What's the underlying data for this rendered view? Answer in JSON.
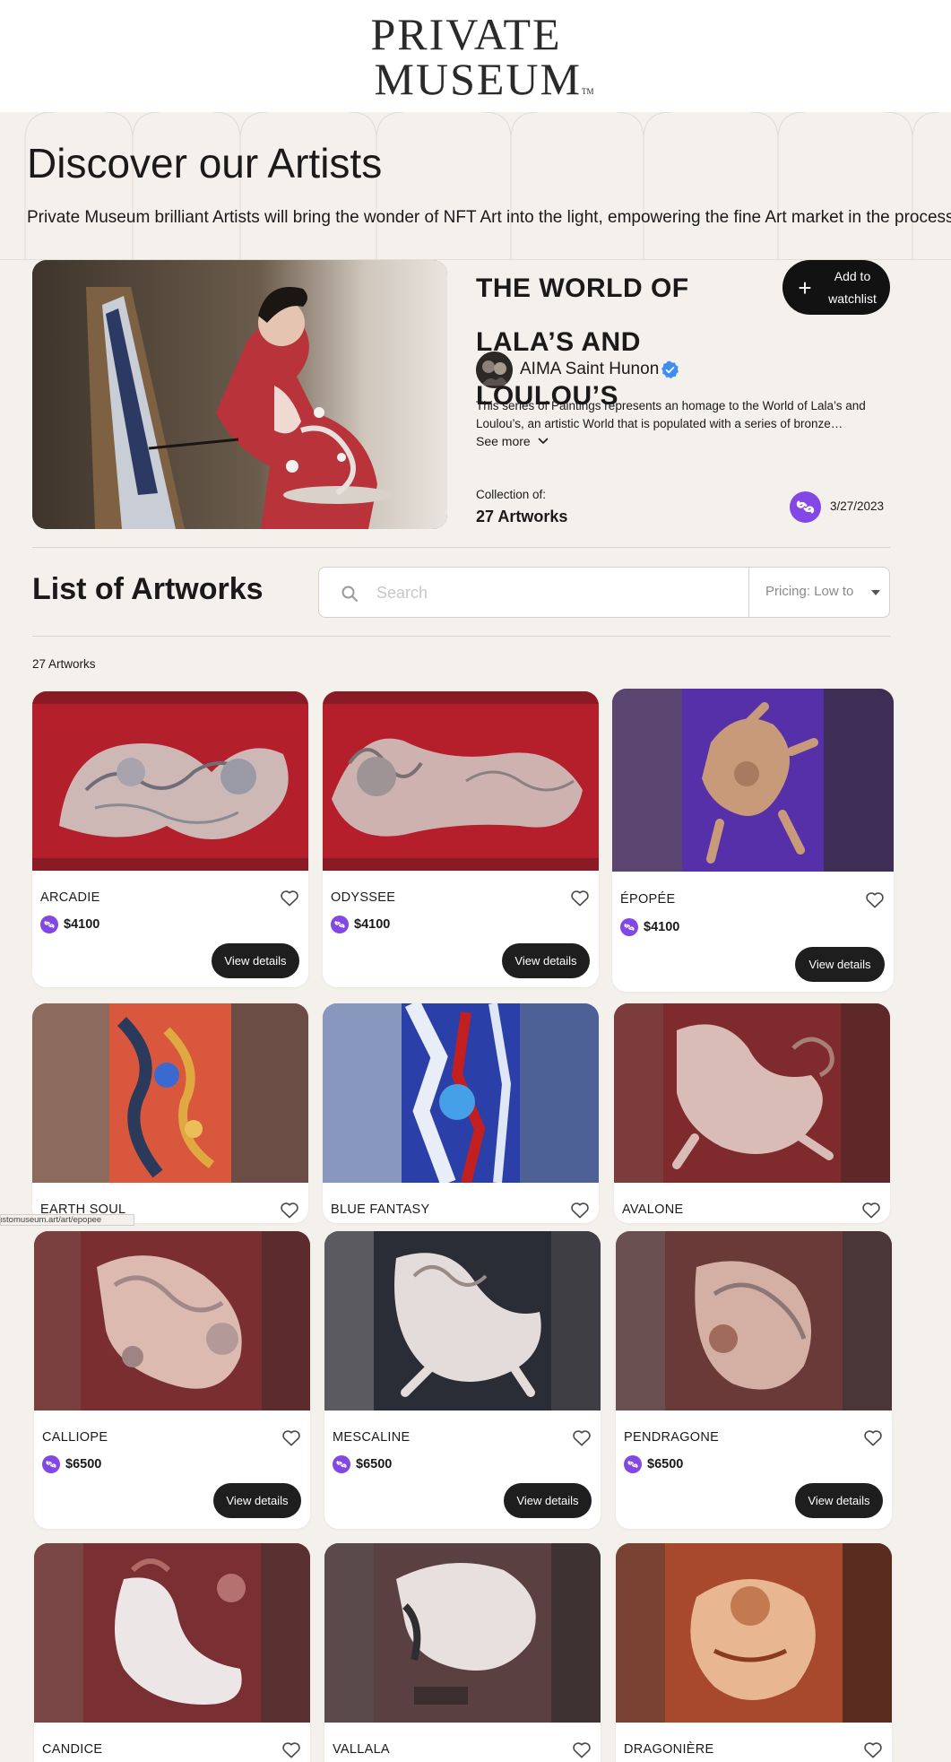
{
  "brand": {
    "line1": "PRIVATE",
    "line2": "MUSEUM",
    "tm": "TM"
  },
  "hero": {
    "title": "Discover our Artists",
    "subtitle": "Private Museum brilliant Artists will bring the wonder of NFT Art into the light, empowering the fine Art market in the process."
  },
  "collection": {
    "title": "THE WORLD OF LALA’S AND LOULOU’S",
    "watchlist_label": "Add to watchlist",
    "author": "AIMA Saint Hunon",
    "description": "This series of Paintings represents an homage to the World of Lala’s and Loulou’s, an artistic World that is populated with a series of bronze…",
    "see_more": "See more",
    "collection_of_label": "Collection of:",
    "count_label": "27 Artworks",
    "date": "3/27/2023"
  },
  "list": {
    "title": "List of Artworks",
    "search_placeholder": "Search",
    "sort_label": "Pricing: Low to",
    "count_label": "27 Artworks"
  },
  "status_tooltip": "ustomuseum.art/art/epopee",
  "colors": {
    "accent_chain": "#8247e5",
    "button_dark": "#1e1e1e",
    "page_bg": "#f4f0eb"
  },
  "artworks": [
    {
      "name": "ARCADIE",
      "price": "$4100",
      "button": "View details"
    },
    {
      "name": "ODYSSEE",
      "price": "$4100",
      "button": "View details"
    },
    {
      "name": "ÉPOPÉE",
      "price": "$4100",
      "button": "View details"
    },
    {
      "name": "EARTH SOUL"
    },
    {
      "name": "BLUE FANTASY"
    },
    {
      "name": "AVALONE"
    },
    {
      "name": "CALLIOPE",
      "price": "$6500",
      "button": "View details"
    },
    {
      "name": "MESCALINE",
      "price": "$6500",
      "button": "View details"
    },
    {
      "name": "PENDRAGONE",
      "price": "$6500",
      "button": "View details"
    },
    {
      "name": "CANDICE"
    },
    {
      "name": "VALLALA"
    },
    {
      "name": "DRAGONIÈRE"
    }
  ]
}
